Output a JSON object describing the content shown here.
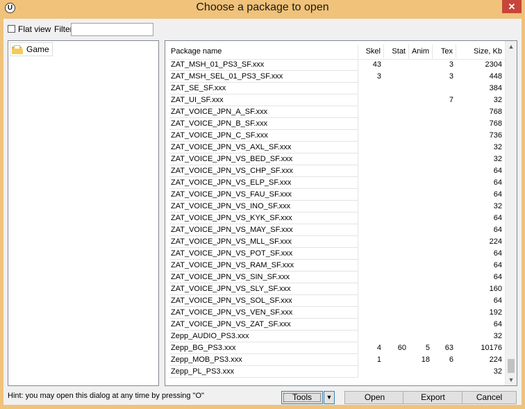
{
  "window": {
    "title": "Choose a package to open",
    "close": "✕",
    "app_icon": "U"
  },
  "toolbar": {
    "flat_view_label": "Flat view",
    "flat_view_checked": false,
    "filter_label": "Filter:",
    "filter_value": ""
  },
  "tree": {
    "items": [
      {
        "label": "Game",
        "icon": "folder-icon"
      }
    ]
  },
  "list": {
    "columns": [
      "Package name",
      "Skel",
      "Stat",
      "Anim",
      "Tex",
      "Size, Kb"
    ],
    "rows": [
      {
        "name": "ZAT_MSH_01_PS3_SF.xxx",
        "skel": "43",
        "stat": "",
        "anim": "",
        "tex": "3",
        "size": "2304"
      },
      {
        "name": "ZAT_MSH_SEL_01_PS3_SF.xxx",
        "skel": "3",
        "stat": "",
        "anim": "",
        "tex": "3",
        "size": "448"
      },
      {
        "name": "ZAT_SE_SF.xxx",
        "skel": "",
        "stat": "",
        "anim": "",
        "tex": "",
        "size": "384"
      },
      {
        "name": "ZAT_UI_SF.xxx",
        "skel": "",
        "stat": "",
        "anim": "",
        "tex": "7",
        "size": "32"
      },
      {
        "name": "ZAT_VOICE_JPN_A_SF.xxx",
        "skel": "",
        "stat": "",
        "anim": "",
        "tex": "",
        "size": "768"
      },
      {
        "name": "ZAT_VOICE_JPN_B_SF.xxx",
        "skel": "",
        "stat": "",
        "anim": "",
        "tex": "",
        "size": "768"
      },
      {
        "name": "ZAT_VOICE_JPN_C_SF.xxx",
        "skel": "",
        "stat": "",
        "anim": "",
        "tex": "",
        "size": "736"
      },
      {
        "name": "ZAT_VOICE_JPN_VS_AXL_SF.xxx",
        "skel": "",
        "stat": "",
        "anim": "",
        "tex": "",
        "size": "32"
      },
      {
        "name": "ZAT_VOICE_JPN_VS_BED_SF.xxx",
        "skel": "",
        "stat": "",
        "anim": "",
        "tex": "",
        "size": "32"
      },
      {
        "name": "ZAT_VOICE_JPN_VS_CHP_SF.xxx",
        "skel": "",
        "stat": "",
        "anim": "",
        "tex": "",
        "size": "64"
      },
      {
        "name": "ZAT_VOICE_JPN_VS_ELP_SF.xxx",
        "skel": "",
        "stat": "",
        "anim": "",
        "tex": "",
        "size": "64"
      },
      {
        "name": "ZAT_VOICE_JPN_VS_FAU_SF.xxx",
        "skel": "",
        "stat": "",
        "anim": "",
        "tex": "",
        "size": "64"
      },
      {
        "name": "ZAT_VOICE_JPN_VS_INO_SF.xxx",
        "skel": "",
        "stat": "",
        "anim": "",
        "tex": "",
        "size": "32"
      },
      {
        "name": "ZAT_VOICE_JPN_VS_KYK_SF.xxx",
        "skel": "",
        "stat": "",
        "anim": "",
        "tex": "",
        "size": "64"
      },
      {
        "name": "ZAT_VOICE_JPN_VS_MAY_SF.xxx",
        "skel": "",
        "stat": "",
        "anim": "",
        "tex": "",
        "size": "64"
      },
      {
        "name": "ZAT_VOICE_JPN_VS_MLL_SF.xxx",
        "skel": "",
        "stat": "",
        "anim": "",
        "tex": "",
        "size": "224"
      },
      {
        "name": "ZAT_VOICE_JPN_VS_POT_SF.xxx",
        "skel": "",
        "stat": "",
        "anim": "",
        "tex": "",
        "size": "64"
      },
      {
        "name": "ZAT_VOICE_JPN_VS_RAM_SF.xxx",
        "skel": "",
        "stat": "",
        "anim": "",
        "tex": "",
        "size": "64"
      },
      {
        "name": "ZAT_VOICE_JPN_VS_SIN_SF.xxx",
        "skel": "",
        "stat": "",
        "anim": "",
        "tex": "",
        "size": "64"
      },
      {
        "name": "ZAT_VOICE_JPN_VS_SLY_SF.xxx",
        "skel": "",
        "stat": "",
        "anim": "",
        "tex": "",
        "size": "160"
      },
      {
        "name": "ZAT_VOICE_JPN_VS_SOL_SF.xxx",
        "skel": "",
        "stat": "",
        "anim": "",
        "tex": "",
        "size": "64"
      },
      {
        "name": "ZAT_VOICE_JPN_VS_VEN_SF.xxx",
        "skel": "",
        "stat": "",
        "anim": "",
        "tex": "",
        "size": "192"
      },
      {
        "name": "ZAT_VOICE_JPN_VS_ZAT_SF.xxx",
        "skel": "",
        "stat": "",
        "anim": "",
        "tex": "",
        "size": "64"
      },
      {
        "name": "Zepp_AUDIO_PS3.xxx",
        "skel": "",
        "stat": "",
        "anim": "",
        "tex": "",
        "size": "32"
      },
      {
        "name": "Zepp_BG_PS3.xxx",
        "skel": "4",
        "stat": "60",
        "anim": "5",
        "tex": "63",
        "size": "10176"
      },
      {
        "name": "Zepp_MOB_PS3.xxx",
        "skel": "1",
        "stat": "",
        "anim": "18",
        "tex": "6",
        "size": "224"
      },
      {
        "name": "Zepp_PL_PS3.xxx",
        "skel": "",
        "stat": "",
        "anim": "",
        "tex": "",
        "size": "32"
      }
    ],
    "scroll_up": "▲",
    "scroll_down": "▼"
  },
  "footer": {
    "hint": "Hint: you may open this dialog at any time by pressing \"O\"",
    "tools_label": "Tools",
    "tools_dropdown": "▼",
    "open_label": "Open",
    "export_label": "Export",
    "cancel_label": "Cancel"
  },
  "colors": {
    "title_bar": "#f0c27a",
    "close_button": "#c7453a",
    "dialog_bg": "#f0f0f0"
  }
}
